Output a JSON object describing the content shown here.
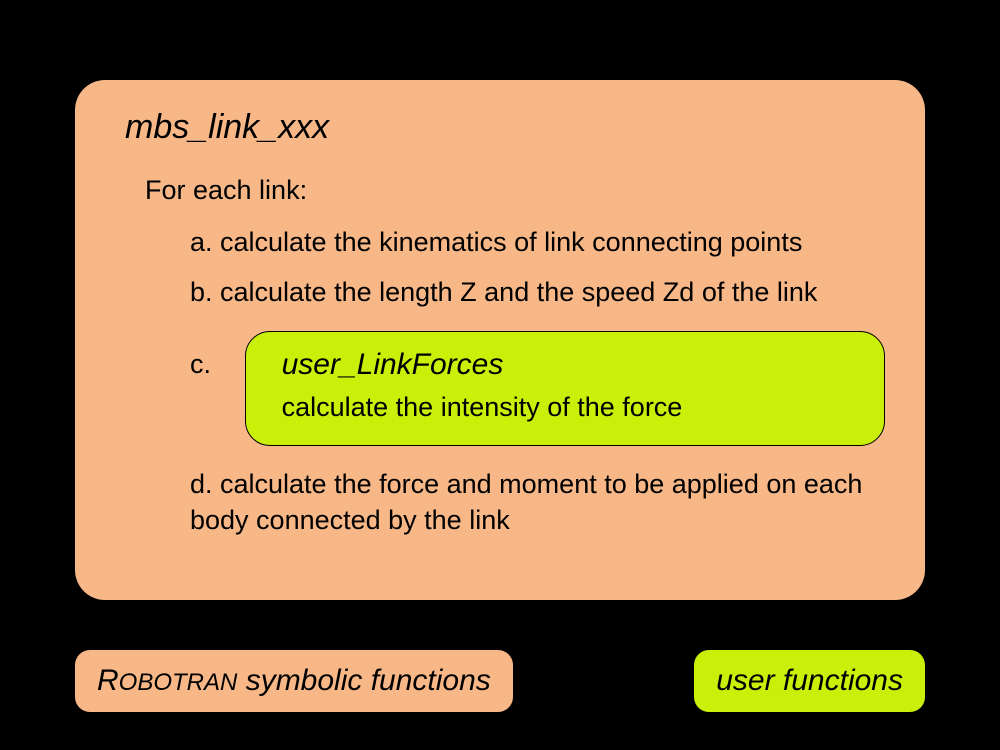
{
  "main": {
    "title": "mbs_link_xxx",
    "intro": "For each link:",
    "items": {
      "a": "calculate the kinematics of link connecting points",
      "b": "calculate the length Z and the speed Zd of the link",
      "c_letter": "c.",
      "c_inner_title": "user_LinkForces",
      "c_inner_text": "calculate the intensity of the force",
      "d": "calculate the force and moment to be applied on each body connected by the link"
    }
  },
  "legend": {
    "symbolic_prefix": "R",
    "symbolic_smallcaps": "OBOTRAN",
    "symbolic_suffix": " symbolic functions",
    "user": "user functions"
  }
}
